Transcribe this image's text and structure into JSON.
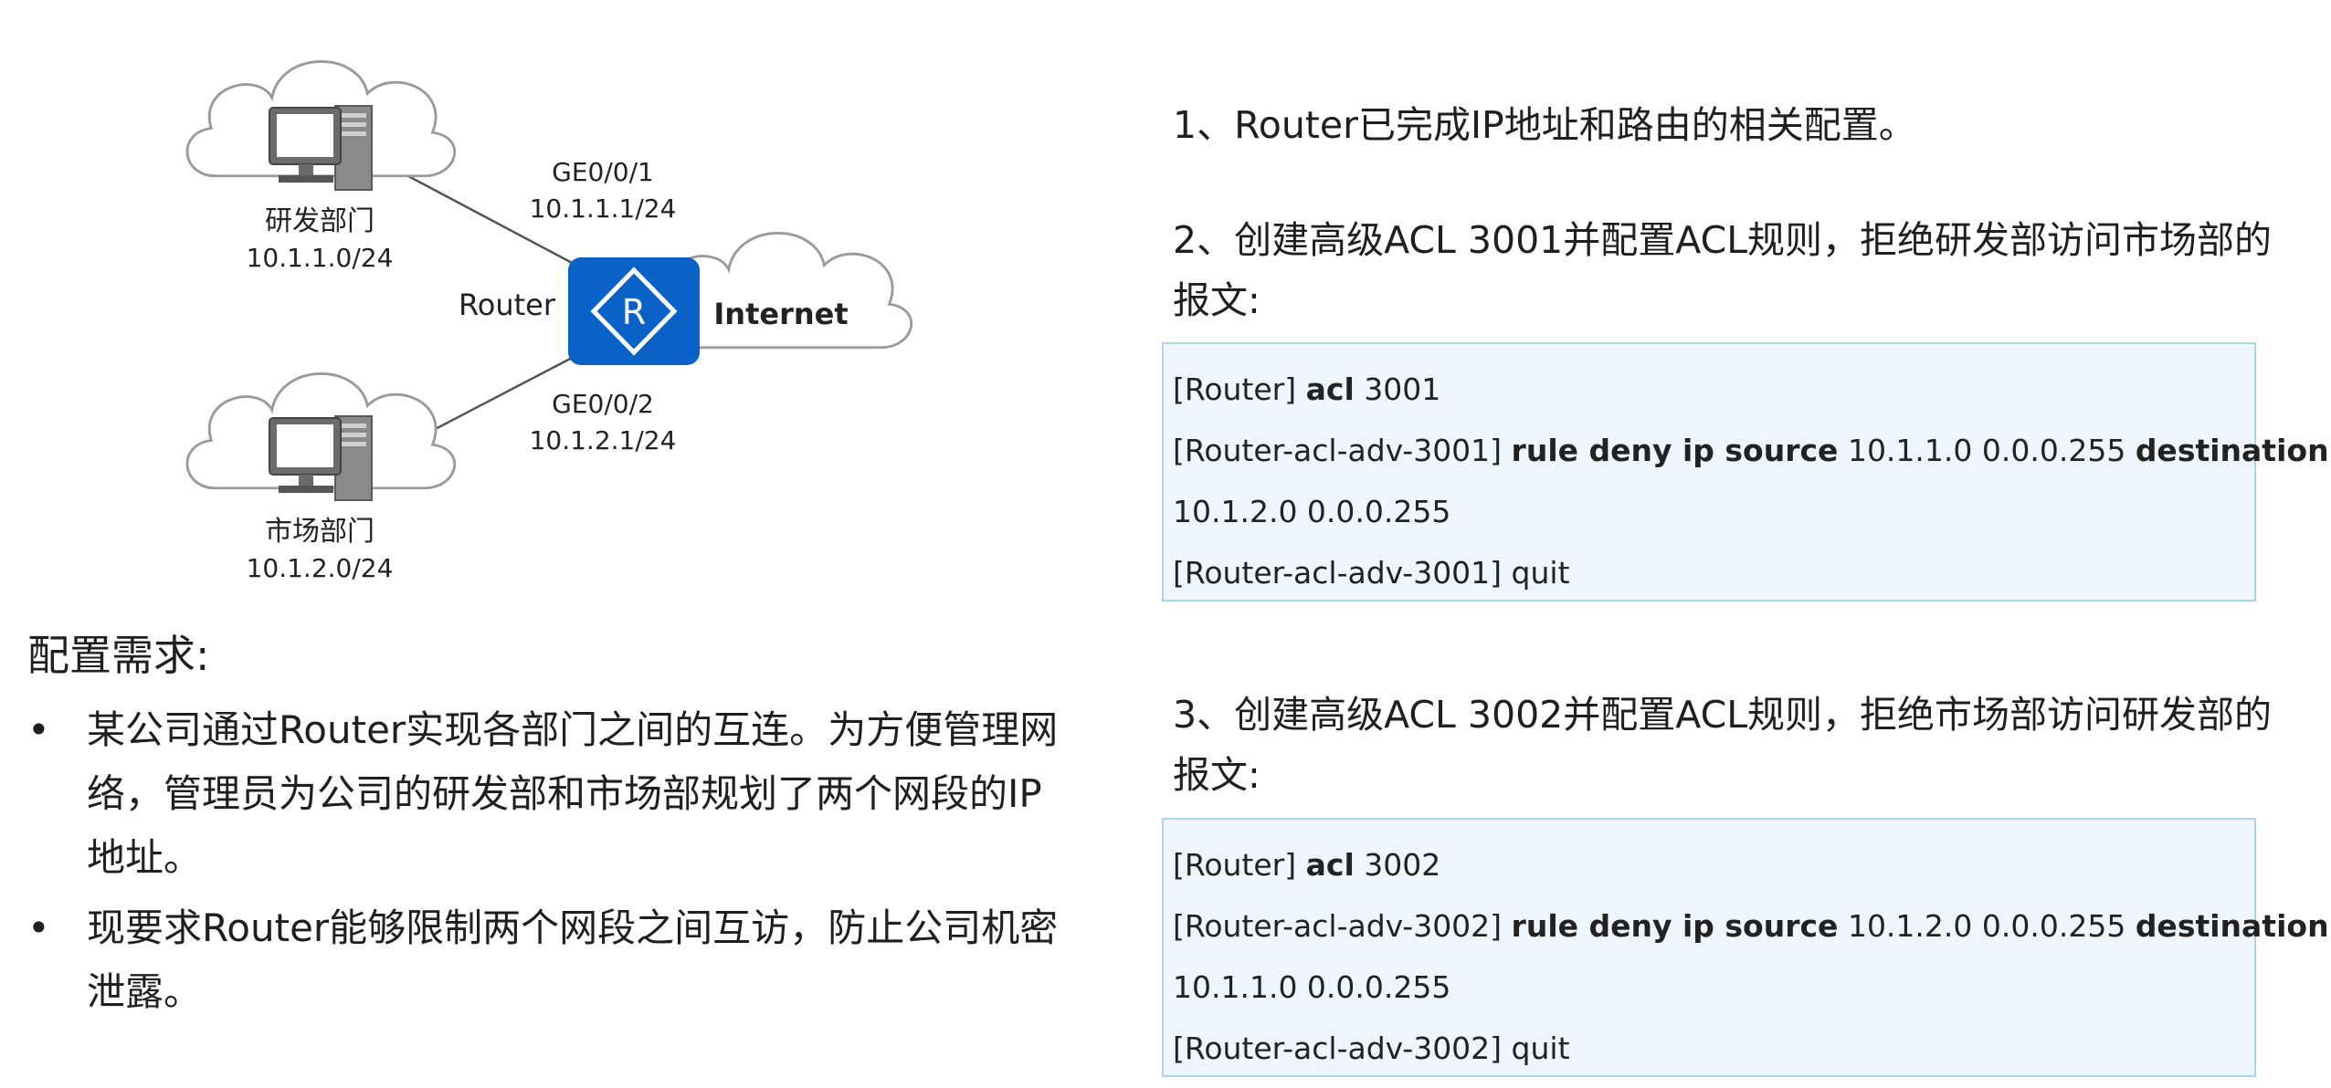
{
  "diagram": {
    "rd_dept": {
      "name": "研发部门",
      "subnet": "10.1.1.0/24"
    },
    "mkt_dept": {
      "name": "市场部门",
      "subnet": "10.1.2.0/24"
    },
    "router_label": "Router",
    "router_glyph": "R",
    "internet_label": "Internet",
    "if_top": {
      "name": "GE0/0/1",
      "ip": "10.1.1.1/24"
    },
    "if_bottom": {
      "name": "GE0/0/2",
      "ip": "10.1.2.1/24"
    },
    "colors": {
      "router": "#0a62c8",
      "cloud_stroke": "#9a9a9a",
      "pc": "#6b6b6b"
    }
  },
  "requirements": {
    "title": "配置需求:",
    "bullet_char": "•",
    "bullets": [
      "某公司通过Router实现各部门之间的互连。为方便管理网络，管理员为公司的研发部和市场部规划了两个网段的IP地址。",
      "现要求Router能够限制两个网段之间互访，防止公司机密泄露。"
    ]
  },
  "steps": [
    "1、Router已完成IP地址和路由的相关配置。",
    "2、创建高级ACL 3001并配置ACL规则，拒绝研发部访问市场部的报文:",
    "3、创建高级ACL 3002并配置ACL规则，拒绝市场部访问研发部的报文:"
  ],
  "code_blocks": [
    {
      "line1": {
        "prompt": "[Router] ",
        "kw": "acl",
        "rest": " 3001"
      },
      "line2": {
        "prompt": "[Router-acl-adv-3001] ",
        "kw1": "rule deny ip source",
        "mid": " 10.1.1.0 0.0.0.255 ",
        "kw2": "destination"
      },
      "line3": "10.1.2.0 0.0.0.255",
      "line4": "[Router-acl-adv-3001] quit"
    },
    {
      "line1": {
        "prompt": "[Router] ",
        "kw": "acl",
        "rest": " 3002"
      },
      "line2": {
        "prompt": "[Router-acl-adv-3002] ",
        "kw1": "rule deny ip source",
        "mid": " 10.1.2.0 0.0.0.255 ",
        "kw2": "destination"
      },
      "line3": "10.1.1.0 0.0.0.255",
      "line4": "[Router-acl-adv-3002] quit"
    }
  ]
}
